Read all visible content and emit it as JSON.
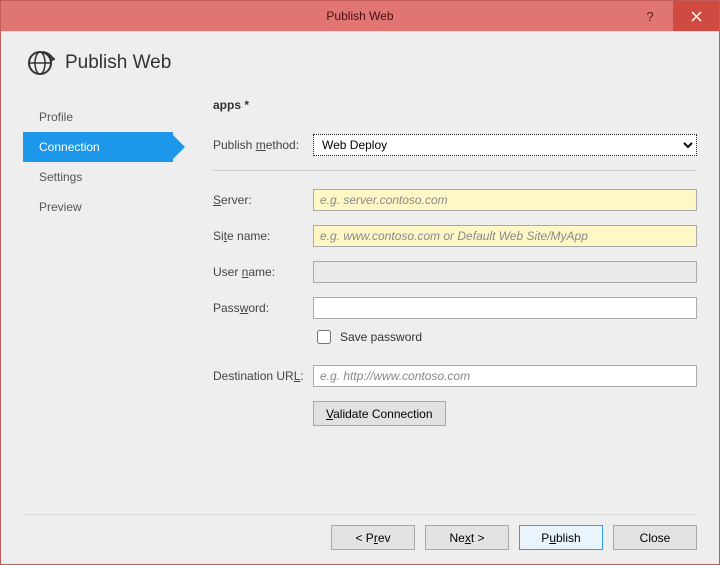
{
  "window": {
    "title": "Publish Web"
  },
  "header": {
    "title": "Publish Web"
  },
  "sidebar": {
    "items": [
      {
        "label": "Profile"
      },
      {
        "label": "Connection"
      },
      {
        "label": "Settings"
      },
      {
        "label": "Preview"
      }
    ],
    "active_index": 1
  },
  "content": {
    "title": "apps *",
    "publish_method": {
      "label_pre": "Publish ",
      "label_ul": "m",
      "label_post": "ethod:",
      "selected": "Web Deploy"
    },
    "server": {
      "label_ul": "S",
      "label_post": "erver:",
      "placeholder": "e.g. server.contoso.com",
      "value": ""
    },
    "site": {
      "label_pre": "Si",
      "label_ul": "t",
      "label_post": "e name:",
      "placeholder": "e.g. www.contoso.com or Default Web Site/MyApp",
      "value": ""
    },
    "user": {
      "label_pre": "User ",
      "label_ul": "n",
      "label_post": "ame:",
      "value": ""
    },
    "password": {
      "label_pre": "Pass",
      "label_ul": "w",
      "label_post": "ord:",
      "value": ""
    },
    "save_password": {
      "label": "Save password",
      "checked": false
    },
    "dest": {
      "label_pre": "Destination UR",
      "label_ul": "L",
      "label_post": ":",
      "placeholder": "e.g. http://www.contoso.com",
      "value": ""
    },
    "validate": {
      "label_ul": "V",
      "label_post": "alidate Connection"
    }
  },
  "footer": {
    "prev": {
      "pre": "< P",
      "ul": "r",
      "post": "ev"
    },
    "next": {
      "pre": "Ne",
      "ul": "x",
      "post": "t >"
    },
    "publish": {
      "pre": "P",
      "ul": "u",
      "post": "blish"
    },
    "close": {
      "label": "Close"
    }
  }
}
